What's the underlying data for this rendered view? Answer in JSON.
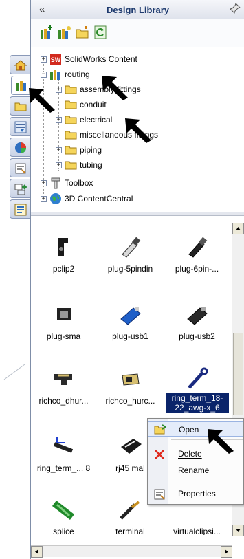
{
  "panel": {
    "title": "Design Library"
  },
  "tree": {
    "nodes": [
      {
        "label": "SolidWorks Content"
      },
      {
        "label": "routing"
      },
      {
        "label": "assembly fittings"
      },
      {
        "label": "conduit"
      },
      {
        "label": "electrical"
      },
      {
        "label": "miscellaneous fittings"
      },
      {
        "label": "piping"
      },
      {
        "label": "tubing"
      },
      {
        "label": "Toolbox"
      },
      {
        "label": "3D ContentCentral"
      }
    ]
  },
  "gallery": {
    "items": [
      {
        "label": "pclip2"
      },
      {
        "label": "plug-5pindin"
      },
      {
        "label": "plug-6pin-..."
      },
      {
        "label": "plug-sma"
      },
      {
        "label": "plug-usb1"
      },
      {
        "label": "plug-usb2"
      },
      {
        "label": "richco_dhur..."
      },
      {
        "label": "richco_hurc..."
      },
      {
        "label": "ring_term_18-22_awg-x_6"
      },
      {
        "label": "ring_term_... 8"
      },
      {
        "label": "rj45 mal"
      },
      {
        "label": "splice"
      },
      {
        "label": "terminal"
      },
      {
        "label": "virtualclipsi..."
      }
    ]
  },
  "context_menu": {
    "items": [
      {
        "label": "Open"
      },
      {
        "label": "Delete"
      },
      {
        "label": "Rename"
      },
      {
        "label": "Properties"
      }
    ]
  },
  "colors": {
    "selection": "#0a246a",
    "title_text": "#1e3a6e",
    "arrow": "#000000"
  }
}
